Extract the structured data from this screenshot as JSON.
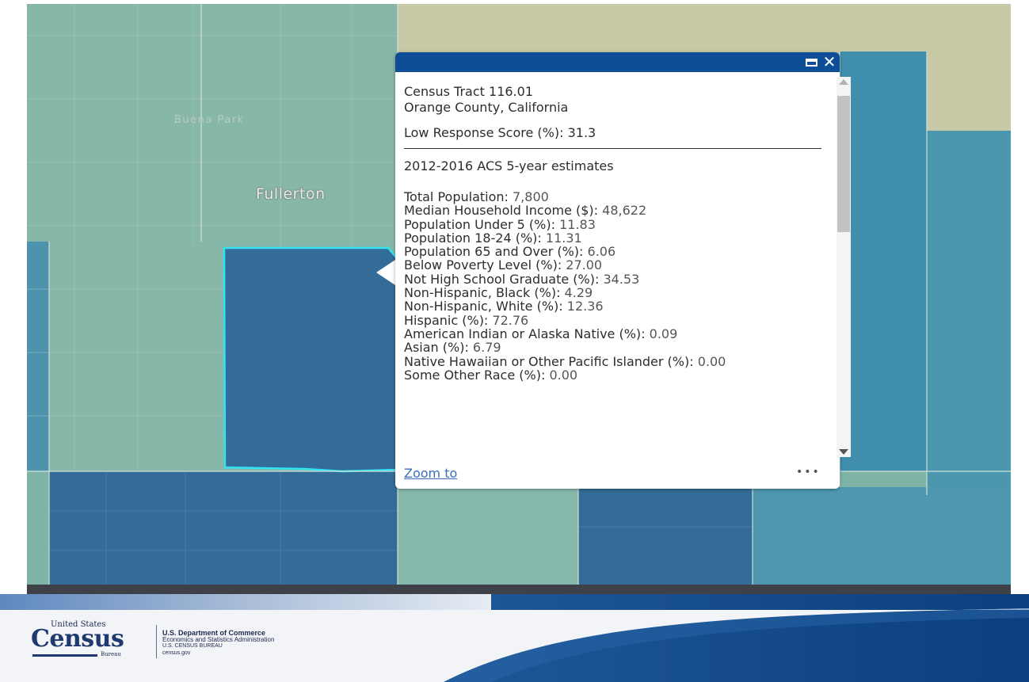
{
  "map": {
    "labels": {
      "city": "Fullerton",
      "faded_place": "Buena Park"
    },
    "colors": {
      "light_teal": "#7fb3a6",
      "tan": "#c8c9a6",
      "mid_blue": "#3f8ead",
      "dark_blue": "#336c98",
      "selection_outline": "#33e3f4"
    }
  },
  "popup": {
    "header_color": "#0e4e97",
    "close_glyph": "✕",
    "tract": "Census Tract 116.01",
    "county": "Orange County, California",
    "score": "Low Response Score (%): 31.3",
    "acs": "2012-2016 ACS 5-year estimates",
    "stats": [
      {
        "label": "Total Population: ",
        "value": "7,800"
      },
      {
        "label": "Median Household Income ($): ",
        "value": "48,622"
      },
      {
        "label": "Population Under 5 (%): ",
        "value": "11.83"
      },
      {
        "label": "Population 18-24 (%): ",
        "value": "11.31"
      },
      {
        "label": "Population 65 and Over (%): ",
        "value": "6.06"
      },
      {
        "label": "Below Poverty Level (%): ",
        "value": "27.00"
      },
      {
        "label": "Not High School Graduate (%): ",
        "value": "34.53"
      },
      {
        "label": "Non-Hispanic, Black (%): ",
        "value": "4.29"
      },
      {
        "label": "Non-Hispanic, White (%): ",
        "value": "12.36"
      },
      {
        "label": "Hispanic (%): ",
        "value": "72.76"
      },
      {
        "label": "American Indian or Alaska Native (%): ",
        "value": "0.09"
      },
      {
        "label": "Asian (%): ",
        "value": "6.79"
      },
      {
        "label": "Native Hawaiian or Other Pacific Islander (%): ",
        "value": "0.00"
      },
      {
        "label": "Some Other Race (%): ",
        "value": "0.00"
      }
    ],
    "zoom_label": "Zoom to",
    "more_label": "•••"
  },
  "footer": {
    "logo_top": "United States",
    "logo_word": "Census",
    "logo_bureau": "Bureau",
    "dept_line1": "U.S. Department of Commerce",
    "dept_line2": "Economics and Statistics Administration",
    "dept_line3": "U.S. CENSUS BUREAU",
    "dept_line4": "census.gov",
    "colors": {
      "navy": "#0b3f7e",
      "light": "#f2f4f7"
    }
  }
}
